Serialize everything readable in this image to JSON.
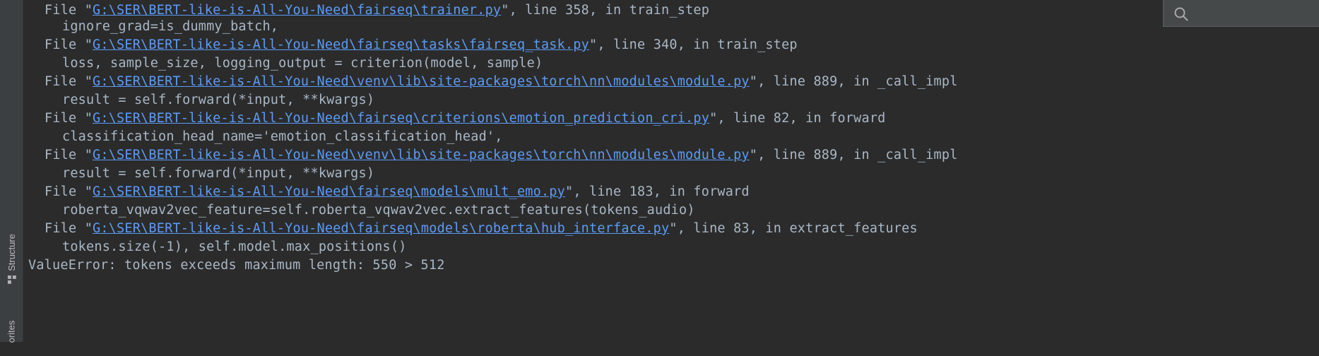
{
  "sidebar": {
    "structure_label": "Structure",
    "favorites_label": "orites"
  },
  "search": {
    "placeholder": ""
  },
  "traceback": [
    {
      "kind": "file",
      "prefix": "File \"",
      "path": "G:\\SER\\BERT-like-is-All-You-Need\\fairseq\\trainer.py",
      "suffix": "\", line 358, in train_step"
    },
    {
      "kind": "code",
      "text": "ignore_grad=is_dummy_batch,"
    },
    {
      "kind": "file",
      "prefix": "File \"",
      "path": "G:\\SER\\BERT-like-is-All-You-Need\\fairseq\\tasks\\fairseq_task.py",
      "suffix": "\", line 340, in train_step"
    },
    {
      "kind": "code",
      "text": "loss, sample_size, logging_output = criterion(model, sample)"
    },
    {
      "kind": "file",
      "prefix": "File \"",
      "path": "G:\\SER\\BERT-like-is-All-You-Need\\venv\\lib\\site-packages\\torch\\nn\\modules\\module.py",
      "suffix": "\", line 889, in _call_impl"
    },
    {
      "kind": "code",
      "text": "result = self.forward(*input, **kwargs)"
    },
    {
      "kind": "file",
      "prefix": "File \"",
      "path": "G:\\SER\\BERT-like-is-All-You-Need\\fairseq\\criterions\\emotion_prediction_cri.py",
      "suffix": "\", line 82, in forward"
    },
    {
      "kind": "code",
      "text": "classification_head_name='emotion_classification_head',"
    },
    {
      "kind": "file",
      "prefix": "File \"",
      "path": "G:\\SER\\BERT-like-is-All-You-Need\\venv\\lib\\site-packages\\torch\\nn\\modules\\module.py",
      "suffix": "\", line 889, in _call_impl"
    },
    {
      "kind": "code",
      "text": "result = self.forward(*input, **kwargs)"
    },
    {
      "kind": "file",
      "prefix": "File \"",
      "path": "G:\\SER\\BERT-like-is-All-You-Need\\fairseq\\models\\mult_emo.py",
      "suffix": "\", line 183, in forward"
    },
    {
      "kind": "code",
      "text": "roberta_vqwav2vec_feature=self.roberta_vqwav2vec.extract_features(tokens_audio)"
    },
    {
      "kind": "file",
      "prefix": "File \"",
      "path": "G:\\SER\\BERT-like-is-All-You-Need\\fairseq\\models\\roberta\\hub_interface.py",
      "suffix": "\", line 83, in extract_features"
    },
    {
      "kind": "code",
      "text": "tokens.size(-1), self.model.max_positions()"
    }
  ],
  "error": {
    "text": "ValueError: tokens exceeds maximum length: 550 > 512"
  },
  "colors": {
    "background": "#2b2b2b",
    "text": "#a9b7c6",
    "link": "#5b9bf5"
  }
}
